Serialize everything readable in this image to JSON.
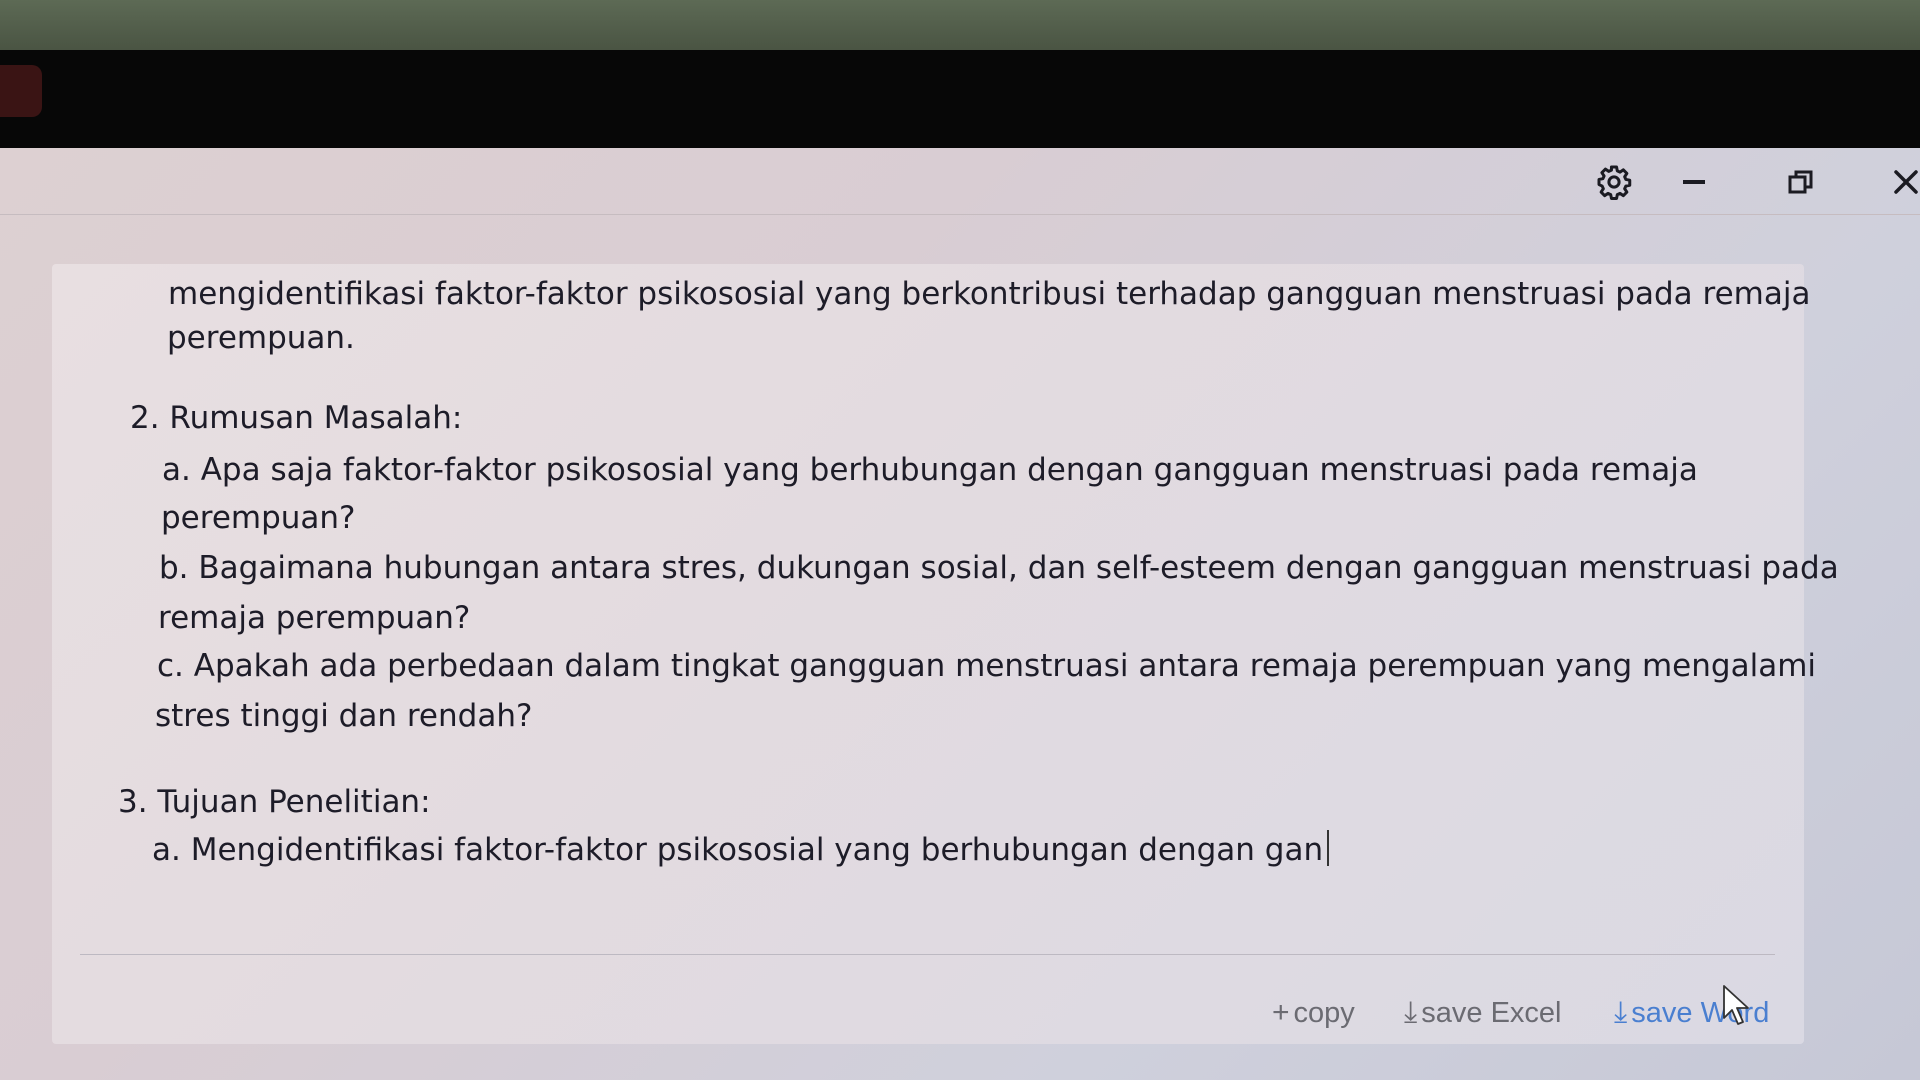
{
  "window": {
    "controls": {
      "settings_icon": "gear-icon",
      "minimize_icon": "minimize-icon",
      "restore_icon": "restore-icon",
      "close_icon": "close-icon"
    }
  },
  "document": {
    "intro_line_1": "mengidentifikasi faktor-faktor psikososial yang berkontribusi terhadap gangguan menstruasi pada remaja",
    "intro_line_2": "perempuan.",
    "section_2_heading": "2. Rumusan Masalah:",
    "q_a_line_1": "a. Apa saja faktor-faktor psikososial yang berhubungan dengan gangguan menstruasi pada remaja",
    "q_a_line_2": "perempuan?",
    "q_b_line_1": "b. Bagaimana hubungan antara stres, dukungan sosial, dan self-esteem dengan gangguan menstruasi pada",
    "q_b_line_2": "remaja perempuan?",
    "q_c_line_1": "c. Apakah ada perbedaan dalam tingkat gangguan menstruasi antara remaja perempuan yang mengalami",
    "q_c_line_2": "stres tinggi dan rendah?",
    "section_3_heading": "3. Tujuan Penelitian:",
    "goal_a_partial": "a. Mengidentifikasi faktor-faktor psikososial yang berhubungan dengan gan"
  },
  "actions": {
    "copy_glyph": "+",
    "copy_label": "copy",
    "save_excel_glyph": "⤓",
    "save_excel_label": "save Excel",
    "save_word_glyph": "⤓",
    "save_word_label": "save Word"
  },
  "colors": {
    "text": "#1d1c28",
    "action_gray": "#6b6b72",
    "action_blue": "#4a7fd0"
  }
}
